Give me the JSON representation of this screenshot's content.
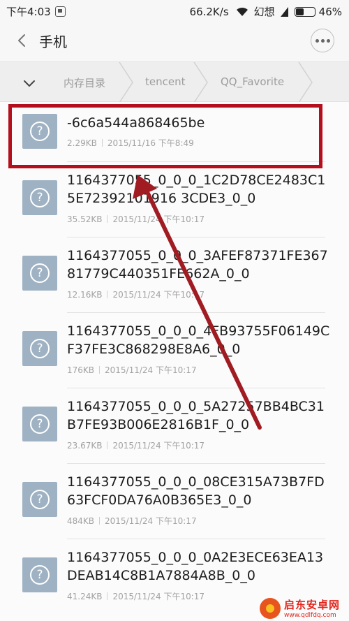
{
  "status_bar": {
    "time": "下午4:03",
    "speed": "66.2K/s",
    "carrier": "幻想",
    "battery": "46%",
    "battery_level": 0.46
  },
  "header": {
    "title": "手机"
  },
  "breadcrumb": {
    "items": [
      "内存目录",
      "tencent",
      "QQ_Favorite"
    ]
  },
  "files": [
    {
      "name": "-6c6a544a868465be",
      "size": "2.29KB",
      "date": "2015/11/16 下午8:49"
    },
    {
      "name": "1164377055_0_0_0_1C2D78CE2483C15E72392101916 3CDE3_0_0",
      "size": "35.52KB",
      "date": "2015/11/24 下午10:17"
    },
    {
      "name": "1164377055_0_0_0_3AFEF87371FE36781779C440351FE662A_0_0",
      "size": "12.16KB",
      "date": "2015/11/24 下午10:17"
    },
    {
      "name": "1164377055_0_0_0_4FB93755F06149CF37FE3C868298E8A6_0_0",
      "size": "176KB",
      "date": "2015/11/24 下午10:17"
    },
    {
      "name": "1164377055_0_0_0_5A27257BB4BC31B7FE93B006E2816B1F_0_0",
      "size": "23.67KB",
      "date": "2015/11/24 下午10:17"
    },
    {
      "name": "1164377055_0_0_0_08CE315A73B7FD63FCF0DA76A0B365E3_0_0",
      "size": "484KB",
      "date": "2015/11/24 下午10:17"
    },
    {
      "name": "1164377055_0_0_0_0A2E3ECE63EA13DEAB14C8B1A7884A8B_0_0",
      "size": "41.24KB",
      "date": "2015/11/24 下午10:17"
    }
  ],
  "watermark": {
    "name": "启东安卓网",
    "url": "www.qdlfdq.com"
  },
  "colors": {
    "highlight": "#b30f1c",
    "arrow": "#a01c22",
    "file_icon": "#9fb2c3"
  }
}
